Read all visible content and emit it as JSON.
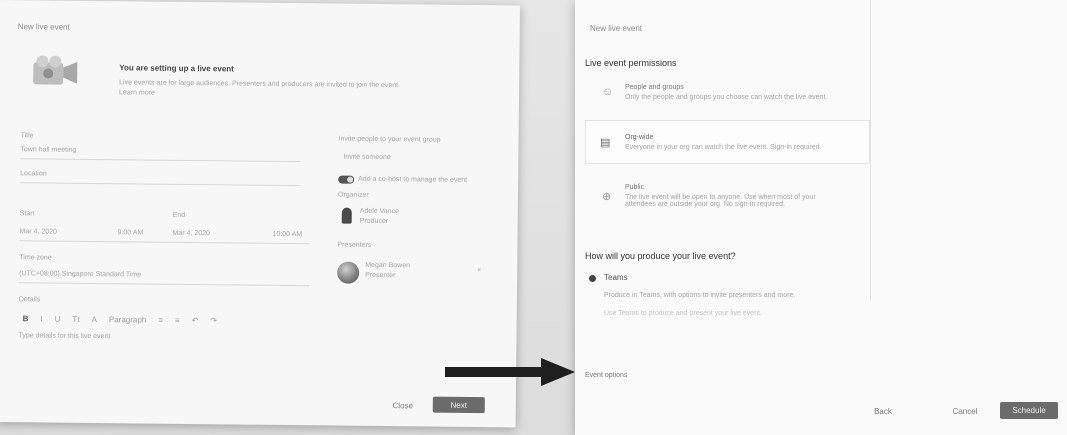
{
  "left_panel": {
    "title": "New live event",
    "setup_title": "You are setting up a live event",
    "setup_desc_1": "Live events are for large audiences. Presenters and producers are invited to join the event.",
    "setup_desc_2": "Learn more",
    "title_label": "Title",
    "title_value": "Town hall meeting",
    "location_label": "Location",
    "start_label": "Start",
    "start_date": "Mar 4, 2020",
    "start_time": "9:00 AM",
    "end_label": "End",
    "end_date": "Mar 4, 2020",
    "end_time": "10:00 AM",
    "timezone_label": "Time zone",
    "timezone_value": "(UTC+08:00) Singapore Standard Time",
    "details_label": "Details",
    "details_placeholder": "Type details for this live event",
    "invite_label": "Invite people to your event group",
    "invite_placeholder": "Invite someone",
    "toggle_label": "Add a co-host to manage the event",
    "organizer_label": "Organizer",
    "organizer_name": "Adele Vance",
    "organizer_role": "Producer",
    "presenter_label": "Presenters",
    "presenter_name": "Megan Bowen",
    "presenter_role": "Presenter",
    "close_label": "Close",
    "next_label": "Next",
    "toolbar": [
      "B",
      "I",
      "U",
      "Tt",
      "A",
      "Paragraph",
      "≡",
      "≡",
      "↶",
      "↷"
    ]
  },
  "right_panel": {
    "title": "New live event",
    "permissions_heading": "Live event permissions",
    "options": [
      {
        "title": "People and groups",
        "desc": "Only the people and groups you choose can watch the live event."
      },
      {
        "title": "Org-wide",
        "desc": "Everyone in your org can watch the live event. Sign-in required."
      },
      {
        "title": "Public",
        "desc": "The live event will be open to anyone. Use when most of your attendees are outside your org. No sign-in required."
      }
    ],
    "produce_heading": "How will you produce your live event?",
    "produce_option": "Teams",
    "produce_desc_1": "Produce in Teams, with options to invite presenters and more.",
    "produce_desc_2": "Use Teams to produce and present your live event.",
    "event_options": "Event options",
    "back_label": "Back",
    "cancel_label": "Cancel",
    "schedule_label": "Schedule"
  },
  "colors": {
    "primary_button": "#6b6b6b",
    "arrow": "#1f1f1f"
  }
}
